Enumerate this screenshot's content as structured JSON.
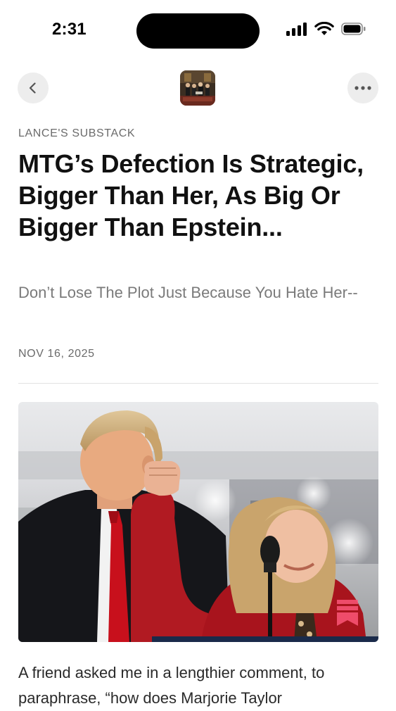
{
  "status_bar": {
    "time": "2:31"
  },
  "nav": {
    "back_icon": "chevron-left-icon",
    "more_icon": "ellipsis-icon",
    "logo_icon": "publication-logo"
  },
  "article": {
    "publication": "LANCE'S SUBSTACK",
    "title": "MTG’s Defection Is Strategic, Bigger Than Her, As Big Or Bigger Than Epstein...",
    "subtitle": "Don’t Lose The Plot Just Because You Hate Her--",
    "date": "NOV 16, 2025",
    "hero_image_alt": "photo",
    "body_first_line": "A friend asked me in a lengthier comment, to paraphrase, “how does Marjorie Taylor"
  },
  "colors": {
    "text": "#111111",
    "muted": "#6b6b6b",
    "button_bg": "#ededed",
    "accent_pink": "#ff5a7e"
  }
}
